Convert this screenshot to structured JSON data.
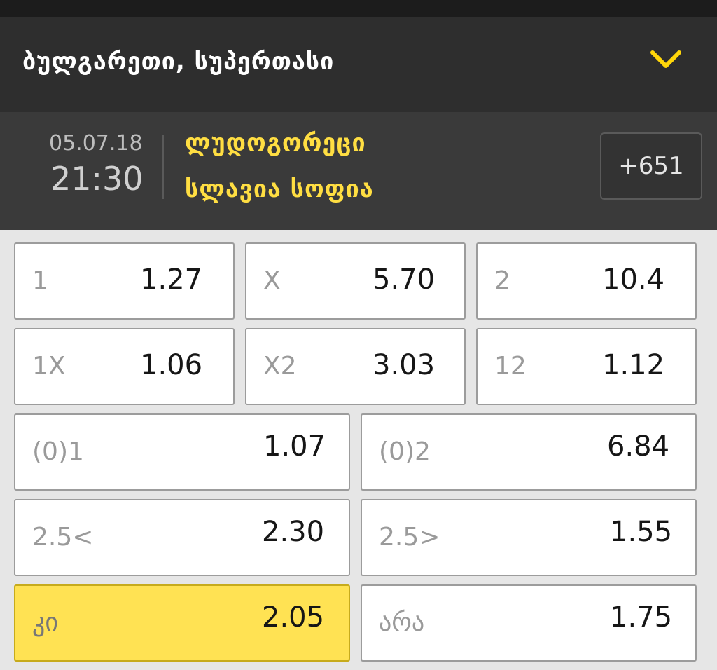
{
  "league": {
    "title": "ბულგარეთი, სუპერთასი",
    "chevron": "chevron-down-icon",
    "accent": "#ffd60a"
  },
  "match": {
    "date": "05.07.18",
    "time": "21:30",
    "home": "ლუდოგორეცი",
    "away": "სლავია სოფია",
    "more_markets": "+651"
  },
  "odds": {
    "r1": [
      {
        "label": "1",
        "value": "1.27"
      },
      {
        "label": "X",
        "value": "5.70"
      },
      {
        "label": "2",
        "value": "10.4"
      }
    ],
    "r2": [
      {
        "label": "1X",
        "value": "1.06"
      },
      {
        "label": "X2",
        "value": "3.03"
      },
      {
        "label": "12",
        "value": "1.12"
      }
    ],
    "r3": [
      {
        "label": "(0)1",
        "value": "1.07"
      },
      {
        "label": "(0)2",
        "value": "6.84"
      }
    ],
    "r4": [
      {
        "label": "2.5<",
        "value": "2.30"
      },
      {
        "label": "2.5>",
        "value": "1.55"
      }
    ],
    "r5": [
      {
        "label": "კი",
        "value": "2.05",
        "selected": true
      },
      {
        "label": "არა",
        "value": "1.75"
      }
    ]
  }
}
